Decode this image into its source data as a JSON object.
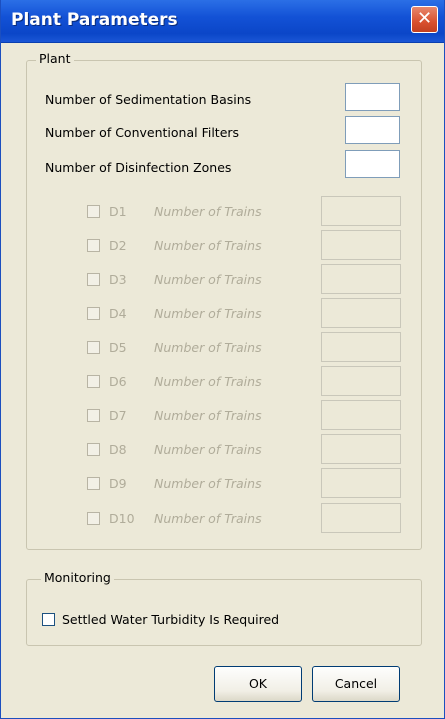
{
  "window": {
    "title": "Plant Parameters",
    "close_glyph": "✕"
  },
  "plant_group": {
    "legend": "Plant",
    "fields": [
      {
        "label": "Number of Sedimentation Basins",
        "value": ""
      },
      {
        "label": "Number of Conventional Filters",
        "value": ""
      },
      {
        "label": "Number of Disinfection Zones",
        "value": ""
      }
    ],
    "zones": [
      {
        "id": "D1",
        "trains_label": "Number of Trains",
        "value": ""
      },
      {
        "id": "D2",
        "trains_label": "Number of Trains",
        "value": ""
      },
      {
        "id": "D3",
        "trains_label": "Number of Trains",
        "value": ""
      },
      {
        "id": "D4",
        "trains_label": "Number of Trains",
        "value": ""
      },
      {
        "id": "D5",
        "trains_label": "Number of Trains",
        "value": ""
      },
      {
        "id": "D6",
        "trains_label": "Number of Trains",
        "value": ""
      },
      {
        "id": "D7",
        "trains_label": "Number of Trains",
        "value": ""
      },
      {
        "id": "D8",
        "trains_label": "Number of Trains",
        "value": ""
      },
      {
        "id": "D9",
        "trains_label": "Number of Trains",
        "value": ""
      },
      {
        "id": "D10",
        "trains_label": "Number of Trains",
        "value": ""
      }
    ]
  },
  "monitoring_group": {
    "legend": "Monitoring",
    "checkbox_label": "Settled Water Turbidity Is Required",
    "checked": false
  },
  "buttons": {
    "ok": "OK",
    "cancel": "Cancel"
  }
}
